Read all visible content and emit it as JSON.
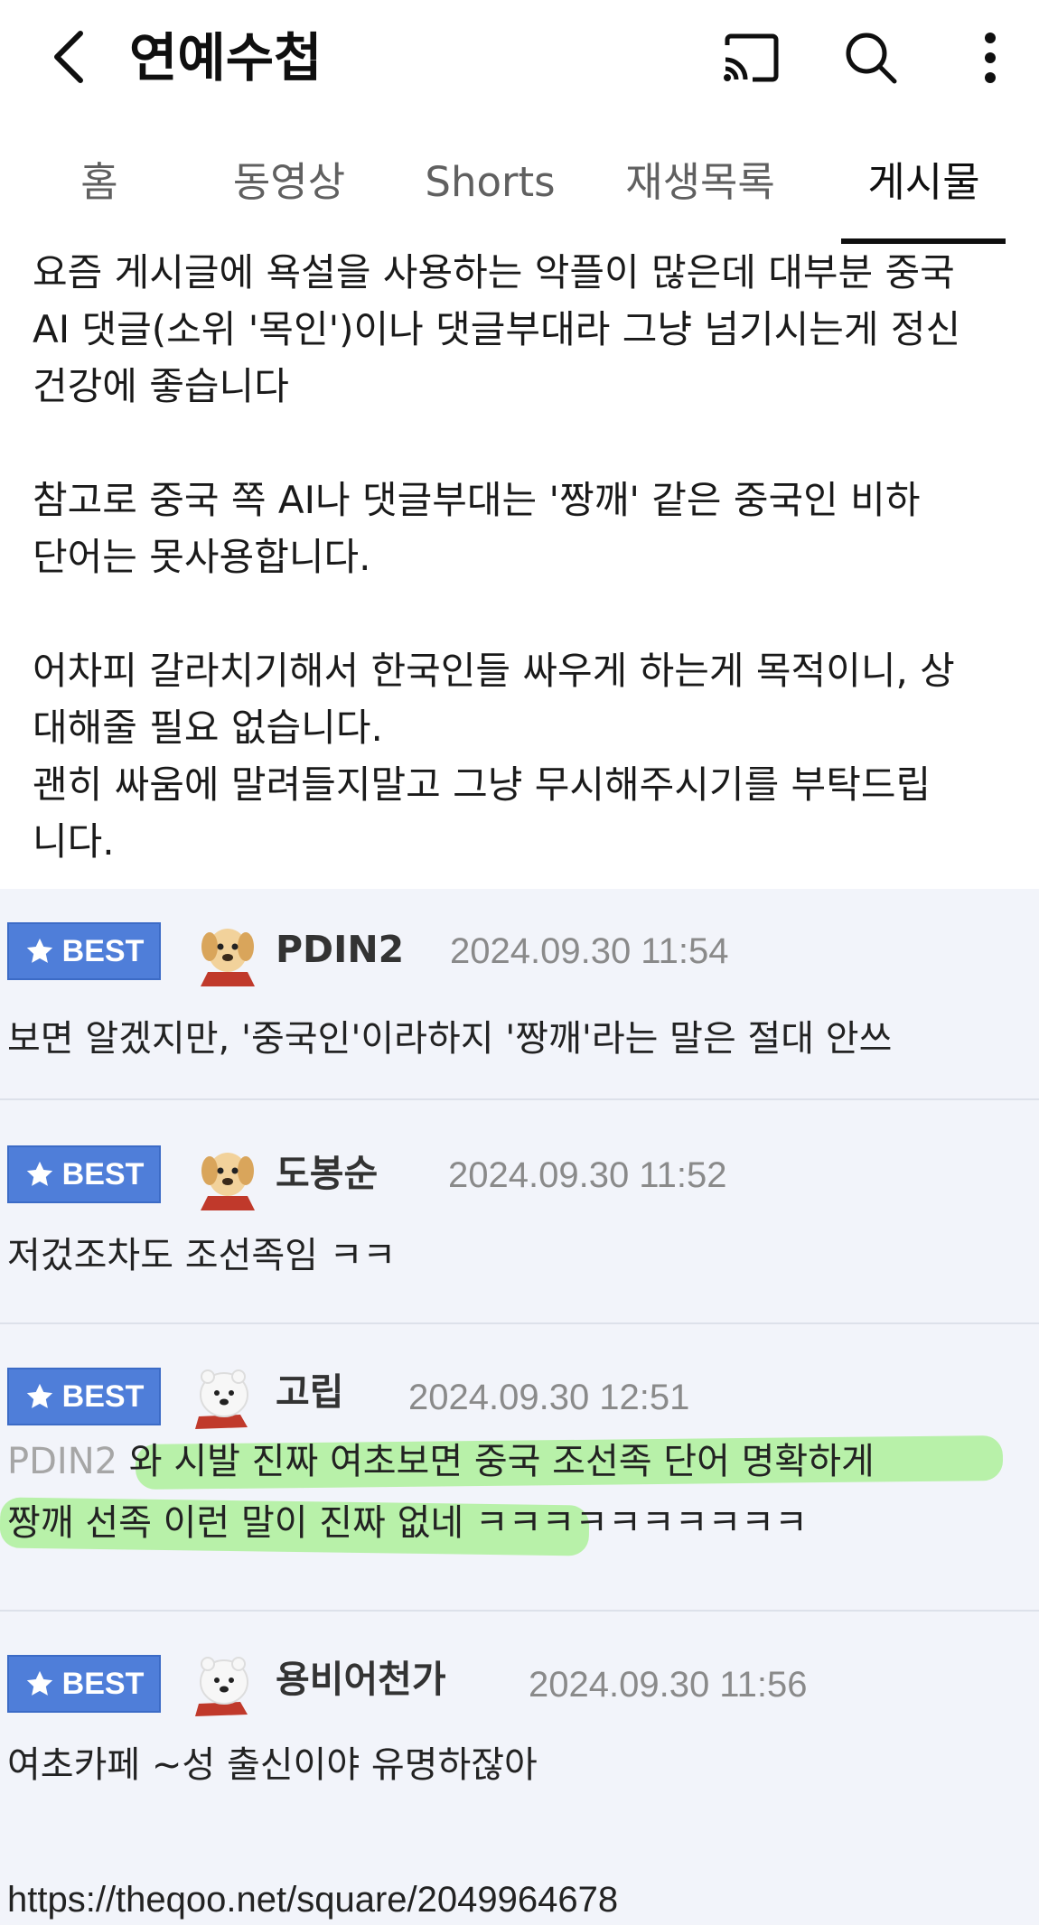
{
  "header": {
    "title": "연예수첩"
  },
  "tabs": [
    {
      "label": "홈",
      "active": false
    },
    {
      "label": "동영상",
      "active": false
    },
    {
      "label": "Shorts",
      "active": false
    },
    {
      "label": "재생목록",
      "active": false
    },
    {
      "label": "게시물",
      "active": true
    }
  ],
  "post": {
    "lines": [
      "요즘 게시글에 욕설을 사용하는 악플이 많은데 대부분 중국",
      "AI 댓글(소위 '목인')이나 댓글부대라 그냥 넘기시는게 정신",
      "건강에 좋습니다",
      "참고로 중국 쪽 AI나 댓글부대는 '짱깨' 같은 중국인 비하",
      "단어는 못사용합니다.",
      "어차피 갈라치기해서 한국인들 싸우게 하는게 목적이니, 상",
      "대해줄 필요 없습니다.",
      "괜히 싸움에 말려들지말고 그냥 무시해주시기를 부탁드립",
      "니다."
    ]
  },
  "comments": [
    {
      "badge": "BEST",
      "nickname": "PDIN2",
      "date": "2024.09.30  11:54",
      "avatar": "puppy-avatar",
      "text": "보면 알겠지만, '중국인'이라하지 '짱깨'라는 말은 절대 안쓰"
    },
    {
      "badge": "BEST",
      "nickname": "도봉순",
      "date": "2024.09.30  11:52",
      "avatar": "puppy-avatar",
      "text": "저겄조차도 조선족임 ㅋㅋ"
    },
    {
      "badge": "BEST",
      "nickname": "고립",
      "date": "2024.09.30  12:51",
      "avatar": "polar-bear-avatar",
      "mention": "PDIN2",
      "text_line1": " 와 시발 진짜 여초보면 중국 조선족 단어 명확하게",
      "text_line2": "짱깨 선족 이런 말이 진짜 없네 ㅋㅋㅋㅋㅋㅋㅋㅋㅋㅋ",
      "highlight_color": "#88ee66"
    },
    {
      "badge": "BEST",
      "nickname": "용비어천가",
      "date": "2024.09.30  11:56",
      "avatar": "polar-bear-avatar",
      "text": "여초카페 ~성 출신이야 유명하잖아"
    }
  ],
  "source_url": "https://theqoo.net/square/2049964678",
  "colors": {
    "badge": "#4f7ed9",
    "comment_bg": "#f2f4fa",
    "highlight": "#88ee66"
  }
}
